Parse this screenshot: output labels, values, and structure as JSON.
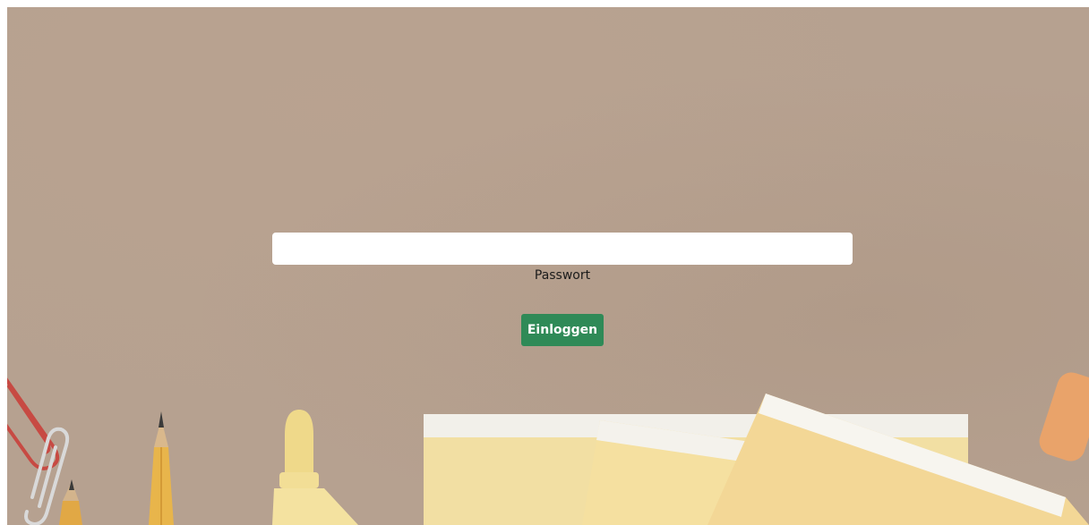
{
  "login": {
    "password_label": "Passwort",
    "password_value": "",
    "submit_label": "Einloggen"
  },
  "colors": {
    "background": "#b6a190",
    "button": "#2f8a57",
    "input": "#ffffff"
  }
}
